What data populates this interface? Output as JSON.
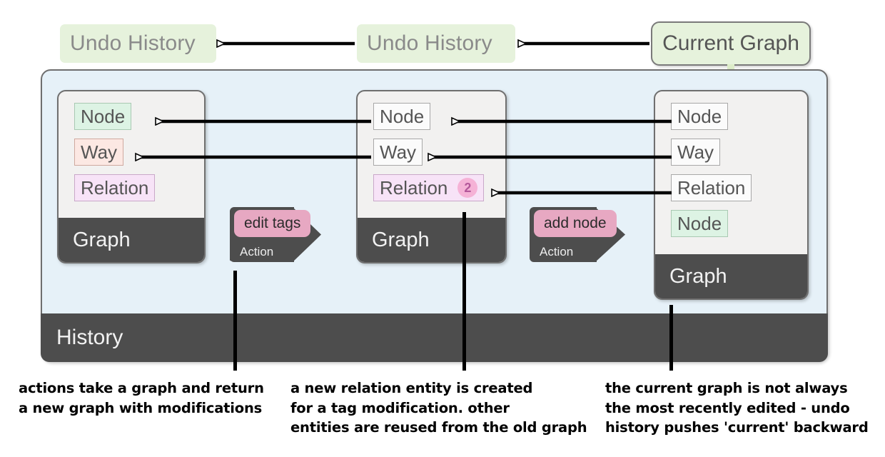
{
  "top_labels": [
    {
      "text": "Undo History",
      "type": "undo"
    },
    {
      "text": "Undo History",
      "type": "undo"
    },
    {
      "text": "Current Graph",
      "type": "current"
    }
  ],
  "history_panel": {
    "label": "History",
    "background": "#e6f1f8",
    "bar_color": "#4d4d4d"
  },
  "graphs": [
    {
      "footer": "Graph",
      "entities": [
        {
          "label": "Node",
          "kind": "node"
        },
        {
          "label": "Way",
          "kind": "way"
        },
        {
          "label": "Relation",
          "kind": "relation"
        }
      ]
    },
    {
      "footer": "Graph",
      "entities": [
        {
          "label": "Node",
          "kind": "plain"
        },
        {
          "label": "Way",
          "kind": "plain"
        },
        {
          "label": "Relation",
          "kind": "relation",
          "badge": "2"
        }
      ]
    },
    {
      "footer": "Graph",
      "entities": [
        {
          "label": "Node",
          "kind": "plain"
        },
        {
          "label": "Way",
          "kind": "plain"
        },
        {
          "label": "Relation",
          "kind": "plain"
        },
        {
          "label": "Node",
          "kind": "node"
        }
      ]
    }
  ],
  "actions": [
    {
      "label": "edit tags",
      "sublabel": "Action"
    },
    {
      "label": "add node",
      "sublabel": "Action"
    }
  ],
  "captions": [
    "actions take a graph and return\na new graph with modifications",
    "a new relation entity is created\nfor a tag modification. other\nentities are reused from the old graph",
    "the current graph is not always\nthe most recently edited - undo\nhistory pushes 'current' backward"
  ],
  "colors": {
    "node": "#ddf3e4",
    "way": "#fce8e3",
    "relation": "#f7e3f7",
    "plain": "#fbfbfb",
    "green_chip": "#e6f2dc",
    "panel": "#e6f1f8",
    "dark_bar": "#4d4d4d",
    "action_pink": "#e7a8c2",
    "badge_pink": "#f5b2d6"
  }
}
